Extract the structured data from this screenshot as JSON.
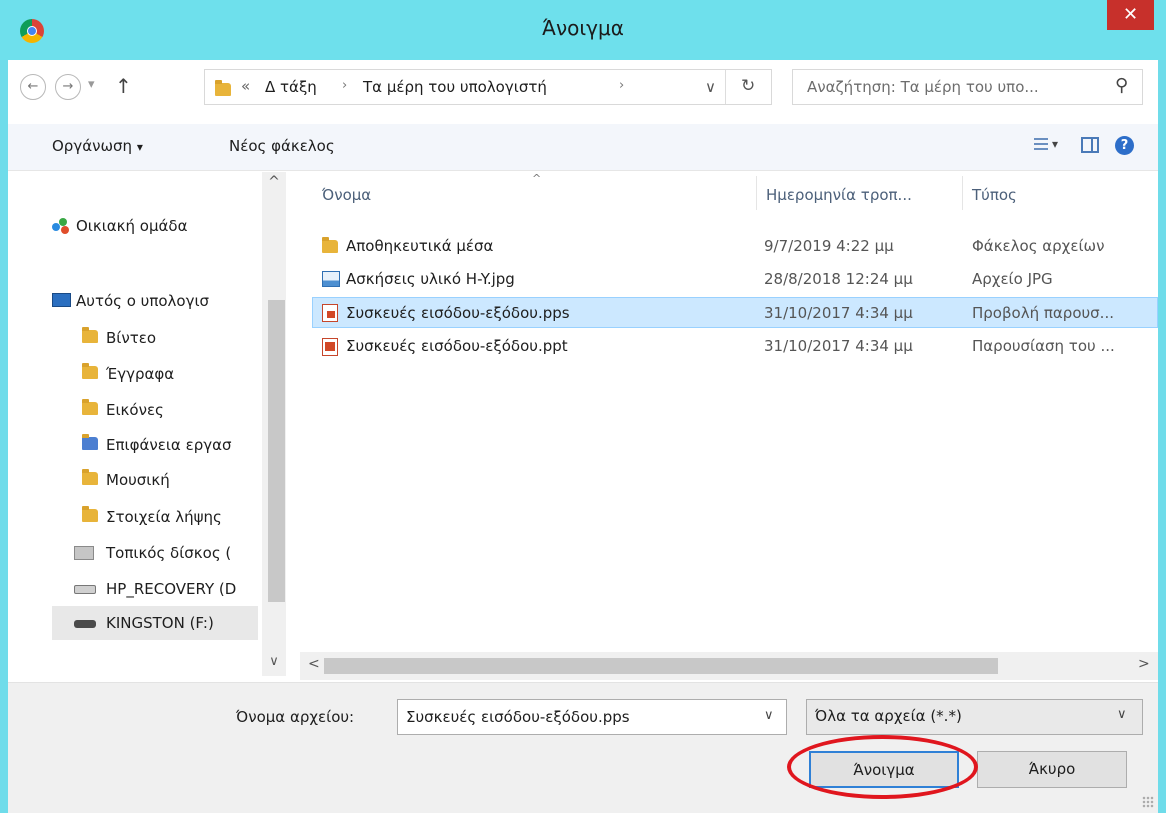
{
  "window": {
    "title": "Άνοιγμα",
    "close_glyph": "✕",
    "colors": {
      "titlebar": "#6ee0ec",
      "close": "#c7302b",
      "selection": "#cce8ff",
      "annotation": "#e0161e"
    }
  },
  "nav": {
    "back_glyph": "←",
    "forward_glyph": "→",
    "recent_glyph": "▾",
    "up_glyph": "↑",
    "breadcrumb_overflow": "«",
    "breadcrumb": [
      "Δ τάξη",
      "Τα μέρη του υπολογιστή"
    ],
    "sep_glyph": "›",
    "dropdown_glyph": "∨",
    "refresh_glyph": "↻",
    "search_placeholder": "Αναζήτηση: Τα μέρη του υπο...",
    "search_glyph": "⚲"
  },
  "toolbar": {
    "organize_label": "Οργάνωση",
    "organize_arrow": "▾",
    "new_folder_label": "Νέος φάκελος",
    "view_arrow": "▾",
    "help_glyph": "?"
  },
  "sidebar": {
    "up_glyph": "^",
    "down_glyph": "∨",
    "items": [
      {
        "label": "Οικιακή ομάδα",
        "icon": "homegroup-icon"
      },
      {
        "label": "Αυτός ο υπολογισ",
        "icon": "computer-icon"
      },
      {
        "label": "Βίντεο",
        "icon": "videos-folder-icon"
      },
      {
        "label": "Έγγραφα",
        "icon": "documents-folder-icon"
      },
      {
        "label": "Εικόνες",
        "icon": "pictures-folder-icon"
      },
      {
        "label": "Επιφάνεια εργασ",
        "icon": "desktop-folder-icon"
      },
      {
        "label": "Μουσική",
        "icon": "music-folder-icon"
      },
      {
        "label": "Στοιχεία λήψης",
        "icon": "downloads-folder-icon"
      },
      {
        "label": "Τοπικός δίσκος (",
        "icon": "local-disk-icon"
      },
      {
        "label": "HP_RECOVERY (D",
        "icon": "drive-icon"
      },
      {
        "label": "KINGSTON (F:)",
        "icon": "usb-drive-icon"
      }
    ]
  },
  "columns": {
    "name": "Όνομα",
    "date": "Ημερομηνία τροπ...",
    "type": "Τύπος",
    "sort_glyph": "^"
  },
  "files": [
    {
      "name": "Αποθηκευτικά μέσα",
      "date": "9/7/2019 4:22 μμ",
      "type": "Φάκελος αρχείων",
      "icon": "folder-icon"
    },
    {
      "name": "Ασκήσεις υλικό H-Y.jpg",
      "date": "28/8/2018 12:24 μμ",
      "type": "Αρχείο JPG",
      "icon": "image-file-icon"
    },
    {
      "name": "Συσκευές εισόδου-εξόδου.pps",
      "date": "31/10/2017 4:34 μμ",
      "type": "Προβολή παρουσ...",
      "icon": "pps-file-icon",
      "selected": true
    },
    {
      "name": "Συσκευές εισόδου-εξόδου.ppt",
      "date": "31/10/2017 4:34 μμ",
      "type": "Παρουσίαση του ...",
      "icon": "ppt-file-icon"
    }
  ],
  "hscroll": {
    "left_glyph": "<",
    "right_glyph": ">"
  },
  "bottom": {
    "filename_label": "Όνομα αρχείου:",
    "filename_value": "Συσκευές εισόδου-εξόδου.pps",
    "filename_arrow": "∨",
    "filter_value": "Όλα τα αρχεία (*.*)",
    "filter_arrow": "∨",
    "open_label": "Άνοιγμα",
    "cancel_label": "Άκυρο"
  }
}
